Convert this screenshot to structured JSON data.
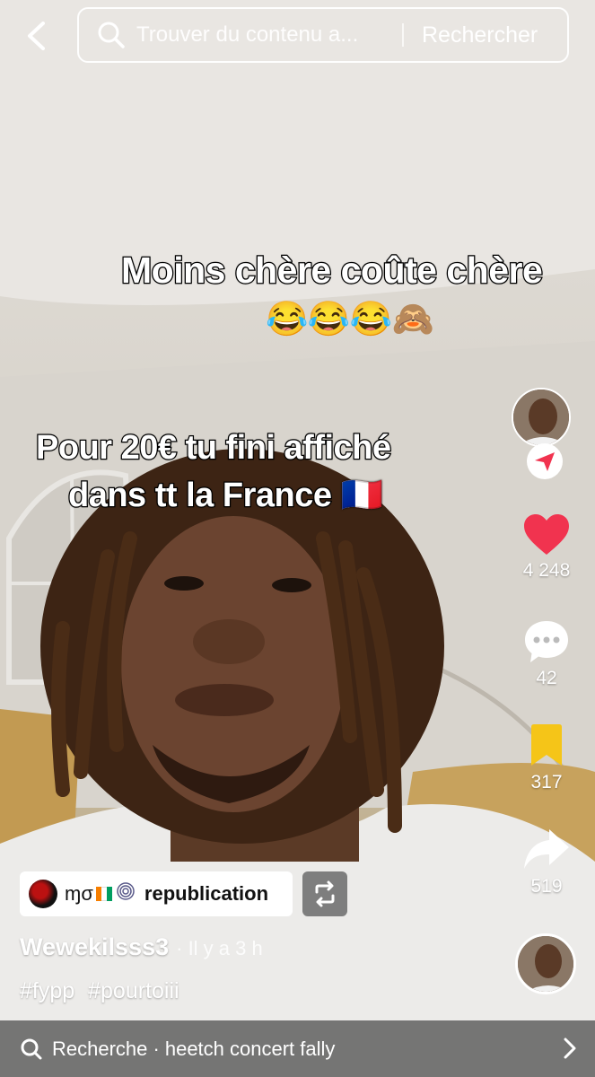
{
  "top_bar": {
    "search_placeholder": "Trouver du contenu a...",
    "search_button": "Rechercher"
  },
  "captions": {
    "line1": "Moins chère coûte chère",
    "line1_emoji": "😂😂😂🙈",
    "line2": "Pour 20€ tu fini affiché",
    "line3": "dans tt la France 🇫🇷"
  },
  "rail": {
    "likes": "4 248",
    "comments": "42",
    "saves": "317",
    "shares": "519"
  },
  "post": {
    "repost_user": "ɱσ",
    "repost_label": "republication",
    "author": "Wewekilsss3",
    "time": "· Il y a 3 h",
    "hashtags": [
      "#fypp",
      "#pourtoiii"
    ]
  },
  "related_search": {
    "label": "Recherche ·",
    "query": "heetch concert fally"
  },
  "colors": {
    "like_red": "#f1334f",
    "save_yellow": "#f5c518",
    "follow_red": "#f1334f"
  }
}
